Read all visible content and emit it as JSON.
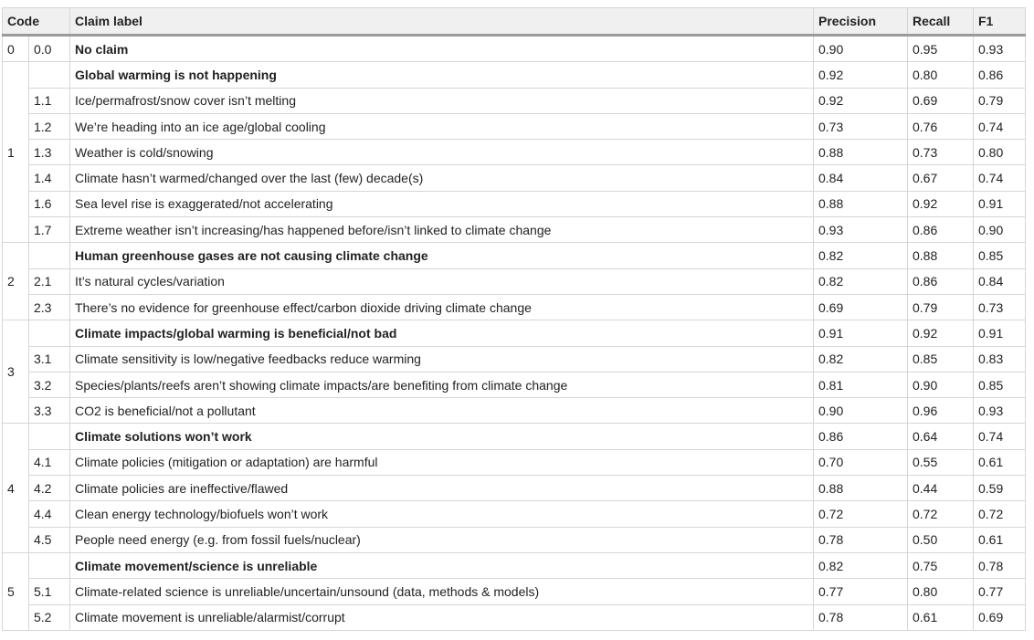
{
  "table": {
    "headers": {
      "code": "Code",
      "label": "Claim label",
      "precision": "Precision",
      "recall": "Recall",
      "f1": "F1"
    },
    "rows": [
      {
        "group": "0",
        "span": 1,
        "sub": "0.0",
        "label": "No claim",
        "bold": true,
        "precision": "0.90",
        "recall": "0.95",
        "f1": "0.93"
      },
      {
        "group": "1",
        "span": 7,
        "sub": "",
        "label": "Global warming is not happening",
        "bold": true,
        "precision": "0.92",
        "recall": "0.80",
        "f1": "0.86"
      },
      {
        "sub": "1.1",
        "label": "Ice/permafrost/snow cover isn’t melting",
        "bold": false,
        "precision": "0.92",
        "recall": "0.69",
        "f1": "0.79"
      },
      {
        "sub": "1.2",
        "label": "We’re heading into an ice age/global cooling",
        "bold": false,
        "precision": "0.73",
        "recall": "0.76",
        "f1": "0.74"
      },
      {
        "sub": "1.3",
        "label": "Weather is cold/snowing",
        "bold": false,
        "precision": "0.88",
        "recall": "0.73",
        "f1": "0.80"
      },
      {
        "sub": "1.4",
        "label": "Climate hasn’t warmed/changed over the last (few) decade(s)",
        "bold": false,
        "precision": "0.84",
        "recall": "0.67",
        "f1": "0.74"
      },
      {
        "sub": "1.6",
        "label": "Sea level rise is exaggerated/not accelerating",
        "bold": false,
        "precision": "0.88",
        "recall": "0.92",
        "f1": "0.91"
      },
      {
        "sub": "1.7",
        "label": "Extreme weather isn’t increasing/has happened before/isn’t linked to climate change",
        "bold": false,
        "precision": "0.93",
        "recall": "0.86",
        "f1": "0.90"
      },
      {
        "group": "2",
        "span": 3,
        "sub": "",
        "label": "Human greenhouse gases are not causing climate change",
        "bold": true,
        "precision": "0.82",
        "recall": "0.88",
        "f1": "0.85"
      },
      {
        "sub": "2.1",
        "label": "It’s natural cycles/variation",
        "bold": false,
        "precision": "0.82",
        "recall": "0.86",
        "f1": "0.84"
      },
      {
        "sub": "2.3",
        "label": "There’s no evidence for greenhouse effect/carbon dioxide driving climate change",
        "bold": false,
        "precision": "0.69",
        "recall": "0.79",
        "f1": "0.73"
      },
      {
        "group": "3",
        "span": 4,
        "sub": "",
        "label": "Climate impacts/global warming is beneficial/not bad",
        "bold": true,
        "precision": "0.91",
        "recall": "0.92",
        "f1": "0.91"
      },
      {
        "sub": "3.1",
        "label": "Climate sensitivity is low/negative feedbacks reduce warming",
        "bold": false,
        "precision": "0.82",
        "recall": "0.85",
        "f1": "0.83"
      },
      {
        "sub": "3.2",
        "label": "Species/plants/reefs aren’t showing climate impacts/are benefiting from climate change",
        "bold": false,
        "precision": "0.81",
        "recall": "0.90",
        "f1": "0.85"
      },
      {
        "sub": "3.3",
        "label": "CO2 is beneficial/not a pollutant",
        "bold": false,
        "precision": "0.90",
        "recall": "0.96",
        "f1": "0.93"
      },
      {
        "group": "4",
        "span": 5,
        "sub": "",
        "label": "Climate solutions won’t work",
        "bold": true,
        "precision": "0.86",
        "recall": "0.64",
        "f1": "0.74"
      },
      {
        "sub": "4.1",
        "label": "Climate policies (mitigation or adaptation) are harmful",
        "bold": false,
        "precision": "0.70",
        "recall": "0.55",
        "f1": "0.61"
      },
      {
        "sub": "4.2",
        "label": "Climate policies are ineffective/flawed",
        "bold": false,
        "precision": "0.88",
        "recall": "0.44",
        "f1": "0.59"
      },
      {
        "sub": "4.4",
        "label": "Clean energy technology/biofuels won’t work",
        "bold": false,
        "precision": "0.72",
        "recall": "0.72",
        "f1": "0.72"
      },
      {
        "sub": "4.5",
        "label": "People need energy (e.g. from fossil fuels/nuclear)",
        "bold": false,
        "precision": "0.78",
        "recall": "0.50",
        "f1": "0.61"
      },
      {
        "group": "5",
        "span": 3,
        "sub": "",
        "label": "Climate movement/science is unreliable",
        "bold": true,
        "precision": "0.82",
        "recall": "0.75",
        "f1": "0.78"
      },
      {
        "sub": "5.1",
        "label": "Climate-related science is unreliable/uncertain/unsound (data, methods & models)",
        "bold": false,
        "precision": "0.77",
        "recall": "0.80",
        "f1": "0.77"
      },
      {
        "sub": "5.2",
        "label": "Climate movement is unreliable/alarmist/corrupt",
        "bold": false,
        "precision": "0.78",
        "recall": "0.61",
        "f1": "0.69"
      }
    ]
  }
}
